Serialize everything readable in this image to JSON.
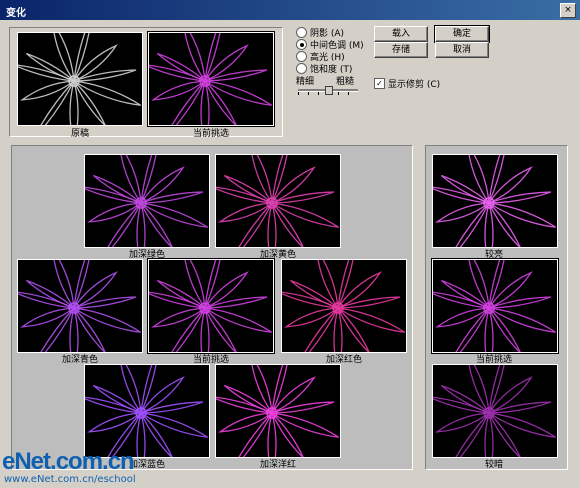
{
  "window": {
    "title": "变化",
    "close_label": "×"
  },
  "top": {
    "original_label": "原稿",
    "current_label": "当前挑选"
  },
  "tone": {
    "options": [
      {
        "label": "阴影 (A)",
        "selected": false
      },
      {
        "label": "中间色调 (M)",
        "selected": true
      },
      {
        "label": "高光 (H)",
        "selected": false
      },
      {
        "label": "饱和度 (T)",
        "selected": false
      }
    ],
    "fine_label": "精细",
    "coarse_label": "粗糙",
    "slider_level": 0.5
  },
  "buttons": {
    "load": "载入",
    "ok": "确定",
    "save": "存储",
    "cancel": "取消"
  },
  "show_clipping": {
    "label": "显示修剪 (C)",
    "checked": true
  },
  "color_grid": {
    "more_green": "加深绿色",
    "more_yellow": "加深黄色",
    "more_cyan": "加深青色",
    "current": "当前挑选",
    "more_red": "加深红色",
    "more_blue": "加深蓝色",
    "more_magenta": "加深洋红"
  },
  "brightness": {
    "lighter": "较亮",
    "current": "当前挑选",
    "darker": "较暗"
  },
  "watermark": {
    "logo": "eNet.com.cn",
    "url": "www.eNet.com.cn/eschool"
  },
  "colors": {
    "tint_magenta": "#d040e0",
    "tint_pink": "#e040c0",
    "tint_purple": "#b050f0",
    "tint_gray": "#d0d0d0"
  }
}
